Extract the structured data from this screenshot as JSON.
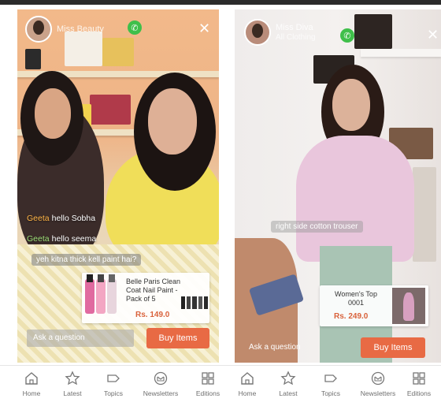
{
  "left": {
    "host_name": "Miss Beauty",
    "chats": [
      {
        "user": "Geeta",
        "text": "hello Sobha"
      },
      {
        "user": "Geeta",
        "text": "hello seema"
      },
      {
        "user": "",
        "text": "yeh kitna thick kell paint hai?"
      }
    ],
    "product": {
      "title": "Belle Paris Clean Coat Nail Paint - Pack of 5",
      "price": "Rs. 149.0"
    },
    "question_placeholder": "Ask a question",
    "buy_label": "Buy Items"
  },
  "right": {
    "host_name": "Miss Diva",
    "host_sub": "All Clothing",
    "chat": "right side cotton trouser",
    "product": {
      "title": "Women's Top 0001",
      "price": "Rs. 249.0"
    },
    "question_placeholder": "Ask a question",
    "buy_label": "Buy Items"
  },
  "nav": {
    "items": [
      {
        "label": "Home",
        "icon": "home-icon"
      },
      {
        "label": "Latest",
        "icon": "star-icon"
      },
      {
        "label": "Topics",
        "icon": "tag-icon"
      },
      {
        "label": "Newsletters",
        "icon": "newsletter-icon"
      },
      {
        "label": "Editions",
        "icon": "editions-icon"
      },
      {
        "label": "Home",
        "icon": "home-icon"
      },
      {
        "label": "Latest",
        "icon": "star-icon"
      },
      {
        "label": "Topics",
        "icon": "tag-icon"
      },
      {
        "label": "Newsletters",
        "icon": "newsletter-icon"
      },
      {
        "label": "Editions",
        "icon": "editions-icon"
      }
    ]
  },
  "colors": {
    "accent": "#e86a44",
    "whatsapp": "#3fbf4a",
    "price": "#d9623b"
  }
}
